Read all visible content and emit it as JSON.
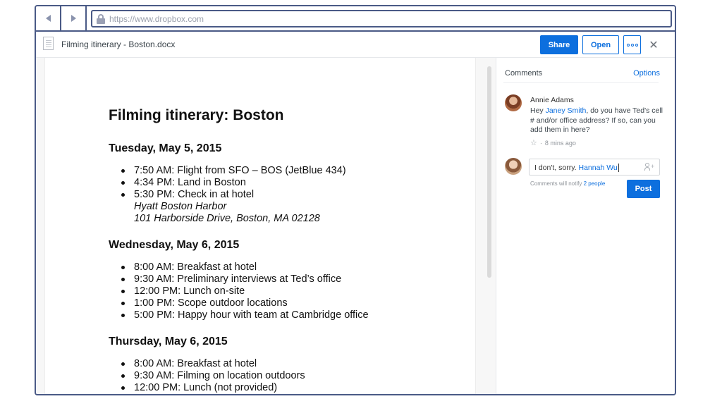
{
  "browser": {
    "url": "https://www.dropbox.com"
  },
  "file": {
    "name": "Filming itinerary - Boston.docx",
    "share_label": "Share",
    "open_label": "Open",
    "close_glyph": "✕"
  },
  "document": {
    "title": "Filming itinerary: Boston",
    "days": [
      {
        "heading": "Tuesday, May 5, 2015",
        "items": [
          {
            "text": "7:50 AM: Flight from SFO – BOS (JetBlue 434)"
          },
          {
            "text": "4:34 PM: Land in Boston"
          },
          {
            "text": "5:30 PM: Check in at hotel",
            "sub1": "Hyatt Boston Harbor",
            "sub2": "101 Harborside Drive, Boston, MA 02128"
          }
        ]
      },
      {
        "heading": "Wednesday, May 6, 2015",
        "items": [
          {
            "text": "8:00 AM: Breakfast at hotel"
          },
          {
            "text": "9:30 AM: Preliminary interviews at Ted’s office"
          },
          {
            "text": "12:00 PM: Lunch on-site"
          },
          {
            "text": "1:00 PM: Scope outdoor locations"
          },
          {
            "text": "5:00 PM: Happy hour with team at Cambridge office"
          }
        ]
      },
      {
        "heading": "Thursday, May 6, 2015",
        "items": [
          {
            "text": "8:00 AM: Breakfast at hotel"
          },
          {
            "text": "9:30 AM: Filming on location outdoors"
          },
          {
            "text": "12:00 PM: Lunch (not provided)"
          }
        ]
      }
    ]
  },
  "comments": {
    "title": "Comments",
    "options_label": "Options",
    "thread": {
      "author": "Annie Adams",
      "text_before": "Hey ",
      "mention": "Janey Smith",
      "text_after": ", do you have Ted's cell # and/or office address? If so, can you add them in here?",
      "time": "8 mins ago",
      "separator": "·"
    },
    "reply": {
      "text": "I don't, sorry. ",
      "mention": "Hannah Wu",
      "notify_prefix": "Comments will notify ",
      "notify_link": "2 people",
      "post_label": "Post"
    }
  },
  "icons": {
    "back": "chevron-left-icon",
    "forward": "chevron-right-icon",
    "lock": "lock-icon",
    "file": "document-icon",
    "more": "more-icon",
    "close": "close-icon",
    "star": "star-icon",
    "add_user": "add-user-icon"
  },
  "colors": {
    "accent": "#0d6fde",
    "frame": "#4a5a86"
  }
}
